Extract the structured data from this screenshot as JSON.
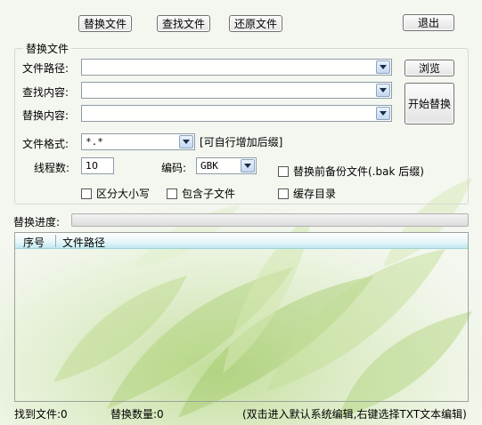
{
  "toolbar": {
    "replace_file": "替换文件",
    "find_file": "查找文件",
    "restore_file": "还原文件",
    "exit": "退出"
  },
  "group": {
    "title": "替换文件"
  },
  "form": {
    "file_path_label": "文件路径:",
    "find_content_label": "查找内容:",
    "replace_content_label": "替换内容:",
    "file_path_value": "",
    "find_content_value": "",
    "replace_content_value": "",
    "browse": "浏览",
    "start_replace": "开始替换",
    "file_format_label": "文件格式:",
    "file_format_value": "*.*",
    "file_format_hint": "[可自行增加后缀]",
    "threads_label": "线程数:",
    "threads_value": "10",
    "encoding_label": "编码:",
    "encoding_value": "GBK",
    "backup_label": "替换前备份文件(.bak 后缀)",
    "case_label": "区分大小写",
    "subfolder_label": "包含子文件",
    "cache_dir_label": "缓存目录"
  },
  "progress": {
    "label": "替换进度:",
    "percent": 0
  },
  "list": {
    "columns": [
      "序号",
      "文件路径"
    ]
  },
  "status": {
    "found": "找到文件:0",
    "replaced": "替换数量:0",
    "hint": "(双击进入默认系统编辑,右键选择TXT文本编辑)"
  }
}
